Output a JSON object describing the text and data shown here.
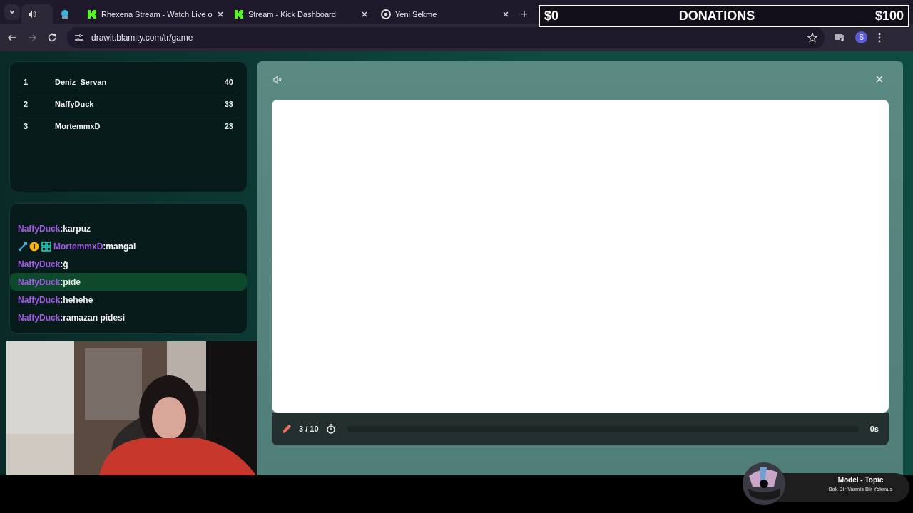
{
  "browser": {
    "tabs": [
      {
        "kind": "audio",
        "selected": true
      },
      {
        "kind": "pinned",
        "selected": false
      },
      {
        "kind": "kick",
        "title": "Rhexena Stream - Watch Live o",
        "selected": false
      },
      {
        "kind": "kick",
        "title": "Stream - Kick Dashboard",
        "selected": false
      },
      {
        "kind": "chrome",
        "title": "Yeni Sekme",
        "selected": false
      }
    ],
    "new_tab": "+",
    "url": "drawit.blamity.com/tr/game",
    "profile": "S"
  },
  "donations": {
    "min": "$0",
    "title": "DONATIONS",
    "max": "$100"
  },
  "leaderboard": [
    {
      "rank": "1",
      "name": "Deniz_Servan",
      "score": "40"
    },
    {
      "rank": "2",
      "name": "NaffyDuck",
      "score": "33"
    },
    {
      "rank": "3",
      "name": "MortemmxD",
      "score": "23"
    }
  ],
  "chat": [
    {
      "user": "NaffyDuck",
      "separator": ":",
      "text": "karpuz",
      "badges": false,
      "highlighted": false
    },
    {
      "user": "MortemmxD",
      "separator": ":",
      "text": "mangal",
      "badges": true,
      "highlighted": false
    },
    {
      "user": "NaffyDuck",
      "separator": ":",
      "text": "ğ",
      "badges": false,
      "highlighted": false
    },
    {
      "user": "NaffyDuck",
      "separator": ":",
      "text": "pide",
      "badges": false,
      "highlighted": true
    },
    {
      "user": "NaffyDuck",
      "separator": ":",
      "text": "hehehe",
      "badges": false,
      "highlighted": false
    },
    {
      "user": "NaffyDuck",
      "separator": ":",
      "text": "ramazan pidesi",
      "badges": false,
      "highlighted": false
    }
  ],
  "game": {
    "round": "3 / 10",
    "timer": {
      "level": 0
    },
    "time": "0s"
  },
  "music": {
    "title": "Model - Topic",
    "subtitle": "Bak Bir Varmis Bir Yokmus"
  }
}
